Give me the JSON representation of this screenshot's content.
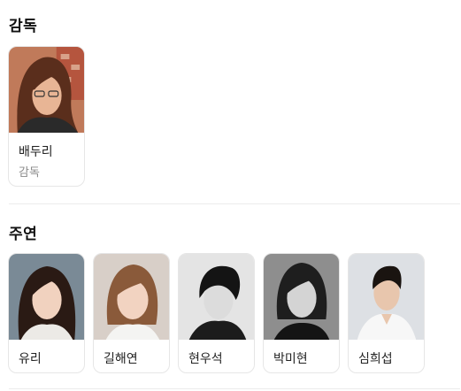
{
  "sections": {
    "director": {
      "title": "감독",
      "people": [
        {
          "name": "배두리",
          "role": "감독"
        }
      ]
    },
    "cast": {
      "title": "주연",
      "people": [
        {
          "name": "유리"
        },
        {
          "name": "길해연"
        },
        {
          "name": "현우석"
        },
        {
          "name": "박미현"
        },
        {
          "name": "심희섭"
        }
      ]
    }
  },
  "colors": {
    "card_border": "#e6e6e6",
    "role_text": "#8a8a8a",
    "divider": "#ececec"
  }
}
